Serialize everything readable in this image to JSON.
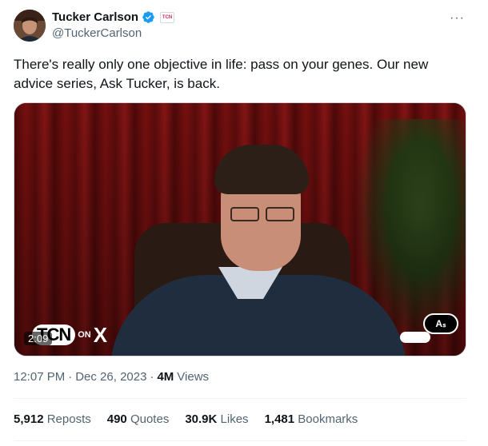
{
  "post": {
    "author_name": "Tucker Carlson",
    "author_handle": "@TuckerCarlson",
    "more_icon": "more-horizontal-icon",
    "text": "There's really only one objective in life: pass on your genes. Our new advice series, Ask Tucker, is back.",
    "video": {
      "duration": "2:09",
      "logo_text": "TCN",
      "logo_on": "ON",
      "logo_x": "X",
      "captions_label": "Aₛ"
    },
    "time": "12:07 PM",
    "date": "Dec 26, 2023",
    "views_count": "4M",
    "views_label": "Views",
    "stats": [
      {
        "count": "5,912",
        "label": "Reposts"
      },
      {
        "count": "490",
        "label": "Quotes"
      },
      {
        "count": "30.9K",
        "label": "Likes"
      },
      {
        "count": "1,481",
        "label": "Bookmarks"
      }
    ],
    "colors": {
      "verified_blue": "#1d9bf0",
      "secondary_text": "#536471",
      "primary_text": "#0f1419"
    }
  }
}
